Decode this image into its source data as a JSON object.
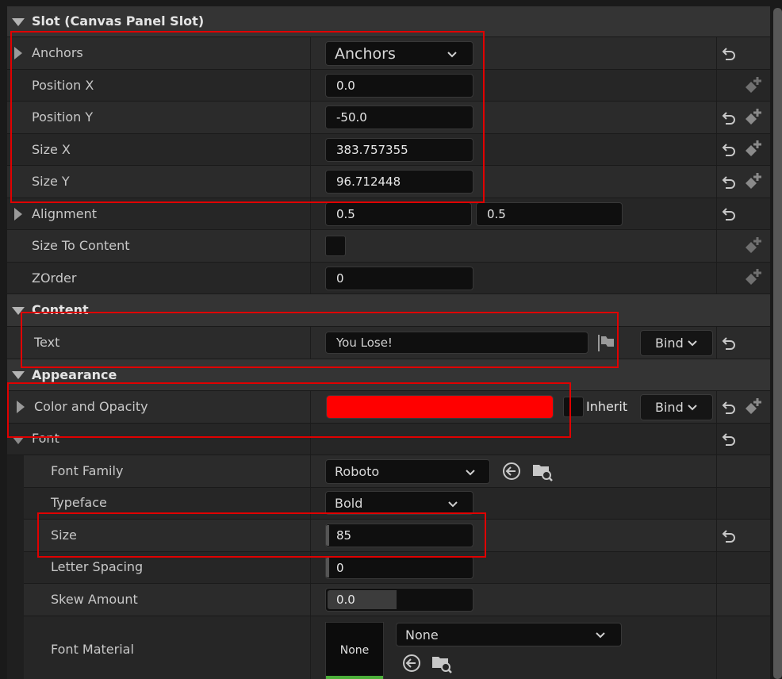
{
  "sections": {
    "slot": "Slot (Canvas Panel Slot)",
    "content": "Content",
    "appearance": "Appearance"
  },
  "slot": {
    "anchors": {
      "label": "Anchors",
      "value": "Anchors"
    },
    "position_x": {
      "label": "Position X",
      "value": "0.0"
    },
    "position_y": {
      "label": "Position Y",
      "value": "-50.0"
    },
    "size_x": {
      "label": "Size X",
      "value": "383.757355"
    },
    "size_y": {
      "label": "Size Y",
      "value": "96.712448"
    },
    "alignment": {
      "label": "Alignment",
      "x": "0.5",
      "y": "0.5"
    },
    "size_to_content": {
      "label": "Size To Content",
      "checked": false
    },
    "zorder": {
      "label": "ZOrder",
      "value": "0"
    }
  },
  "content": {
    "text": {
      "label": "Text",
      "value": "You Lose!",
      "bind_label": "Bind"
    }
  },
  "appearance": {
    "color_opacity": {
      "label": "Color and Opacity",
      "color": "#ff0000",
      "inherit_label": "Inherit",
      "bind_label": "Bind"
    },
    "font": {
      "label": "Font",
      "family": {
        "label": "Font Family",
        "value": "Roboto"
      },
      "typeface": {
        "label": "Typeface",
        "value": "Bold"
      },
      "size": {
        "label": "Size",
        "value": "85"
      },
      "letter_spacing": {
        "label": "Letter Spacing",
        "value": "0"
      },
      "skew": {
        "label": "Skew Amount",
        "value": "0.0"
      },
      "material": {
        "label": "Font Material",
        "thumb_label": "None",
        "value": "None"
      }
    }
  },
  "colors": {
    "highlight": "#e00000",
    "accent_green": "#4caf3a"
  },
  "icons": [
    "expand-triangle-icon",
    "collapse-triangle-icon",
    "reset-to-default-icon",
    "add-keyframe-icon",
    "chevron-down-icon",
    "flag-icon",
    "use-selected-asset-icon",
    "browse-asset-icon"
  ]
}
